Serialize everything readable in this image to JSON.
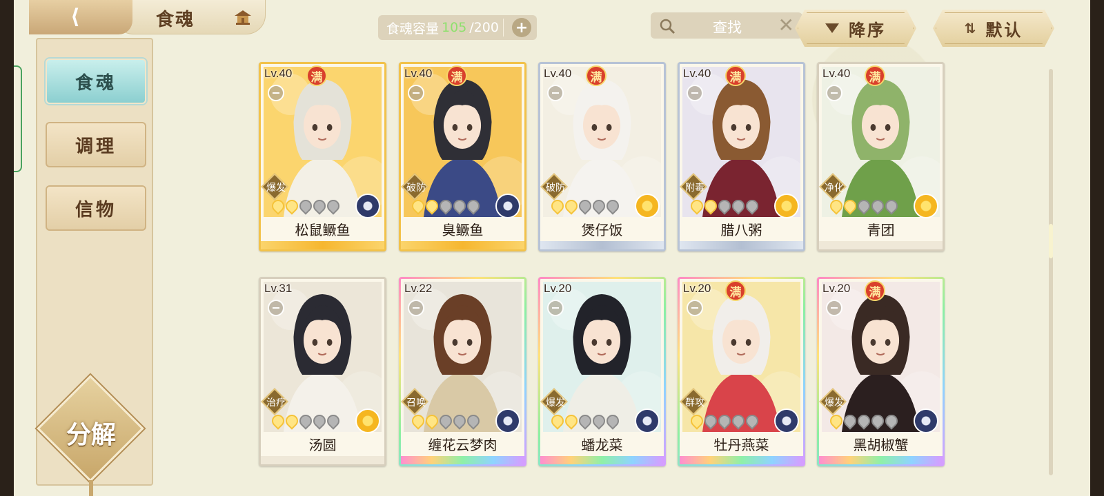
{
  "header": {
    "title": "食魂",
    "capacity_label": "食魂容量",
    "capacity_current": "105",
    "capacity_total": "/200",
    "search_placeholder": "查找",
    "sort_label": "降序",
    "filter_label": "默认"
  },
  "sidebar": {
    "tabs": [
      {
        "label": "食魂",
        "active": true
      },
      {
        "label": "调理",
        "active": false
      },
      {
        "label": "信物",
        "active": false
      }
    ],
    "decompose_label": "分解"
  },
  "cards": [
    {
      "level": "Lv.40",
      "max": "满",
      "role": "爆发",
      "name": "松鼠鳜鱼",
      "stars": 2,
      "element": "blue",
      "frame": "gold",
      "bg": "#fbd56e",
      "hair": "#e4e2d8",
      "outfit": "#f3f0e6"
    },
    {
      "level": "Lv.40",
      "max": "满",
      "role": "破防",
      "name": "臭鳜鱼",
      "stars": 2,
      "element": "blue",
      "frame": "gold",
      "bg": "#f7c75a",
      "hair": "#2f2f36",
      "outfit": "#3b4a86"
    },
    {
      "level": "Lv.40",
      "max": "满",
      "role": "破防",
      "name": "煲仔饭",
      "stars": 2,
      "element": "gold",
      "frame": "silver",
      "bg": "#f3efe3",
      "hair": "#f4f2ee",
      "outfit": "#f5f3ef"
    },
    {
      "level": "Lv.40",
      "max": "满",
      "role": "附毒",
      "name": "腊八粥",
      "stars": 2,
      "element": "gold",
      "frame": "silver",
      "bg": "#e8e4ee",
      "hair": "#8a5a32",
      "outfit": "#7a2430"
    },
    {
      "level": "Lv.40",
      "max": "满",
      "role": "净化",
      "name": "青团",
      "stars": 2,
      "element": "gold",
      "frame": "plain",
      "bg": "#eef1e4",
      "hair": "#8fb36a",
      "outfit": "#6fa04a"
    },
    {
      "level": "Lv.31",
      "max": "",
      "role": "治疗",
      "name": "汤圆",
      "stars": 2,
      "element": "gold",
      "frame": "plain",
      "bg": "#ece6d8",
      "hair": "#2b2b33",
      "outfit": "#f4f1ea"
    },
    {
      "level": "Lv.22",
      "max": "",
      "role": "召唤",
      "name": "缠花云梦肉",
      "stars": 2,
      "element": "blue",
      "frame": "rainbow",
      "bg": "#e8e4da",
      "hair": "#6a3f27",
      "outfit": "#d9c9a6"
    },
    {
      "level": "Lv.20",
      "max": "",
      "role": "爆发",
      "name": "蟠龙菜",
      "stars": 2,
      "element": "blue",
      "frame": "rainbow",
      "bg": "#dff0ec",
      "hair": "#22232a",
      "outfit": "#efeee6"
    },
    {
      "level": "Lv.20",
      "max": "满",
      "role": "群攻",
      "name": "牡丹燕菜",
      "stars": 1,
      "element": "blue",
      "frame": "rainbow",
      "bg": "#f6e6a8",
      "hair": "#f1eeea",
      "outfit": "#d9444a"
    },
    {
      "level": "Lv.20",
      "max": "满",
      "role": "爆发",
      "name": "黑胡椒蟹",
      "stars": 1,
      "element": "blue",
      "frame": "rainbow",
      "bg": "#f3e9e6",
      "hair": "#3a2a24",
      "outfit": "#2b1f1f"
    }
  ]
}
